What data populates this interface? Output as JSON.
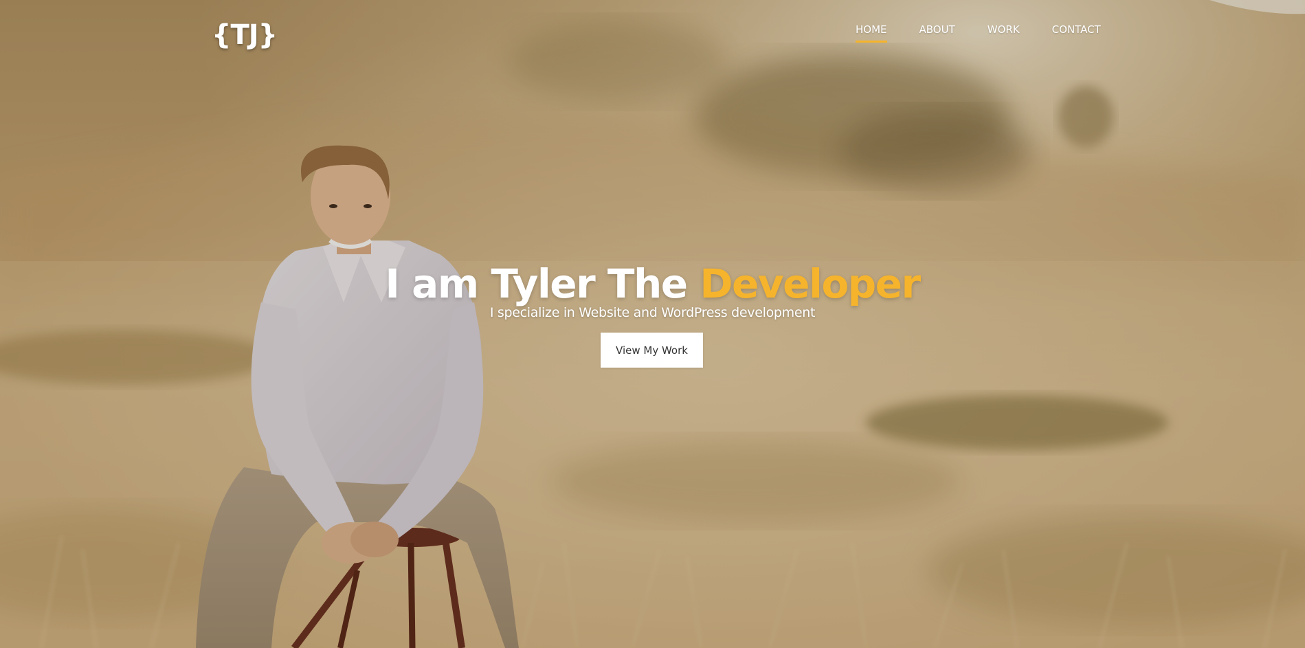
{
  "header": {
    "logo_text": "{TJ}",
    "nav": [
      {
        "label": "HOME",
        "active": true
      },
      {
        "label": "ABOUT",
        "active": false
      },
      {
        "label": "WORK",
        "active": false
      },
      {
        "label": "CONTACT",
        "active": false
      }
    ]
  },
  "hero": {
    "headline_prefix": "I am Tyler The ",
    "headline_accent": "Developer",
    "subheadline": "I specialize in Website and WordPress development",
    "cta_label": "View My Work",
    "background": "photo-man-sitting-on-stool-in-golden-field"
  },
  "colors": {
    "accent": "#f6b42c",
    "text": "#ffffff",
    "button_bg": "#ffffff",
    "button_text": "#333333"
  }
}
